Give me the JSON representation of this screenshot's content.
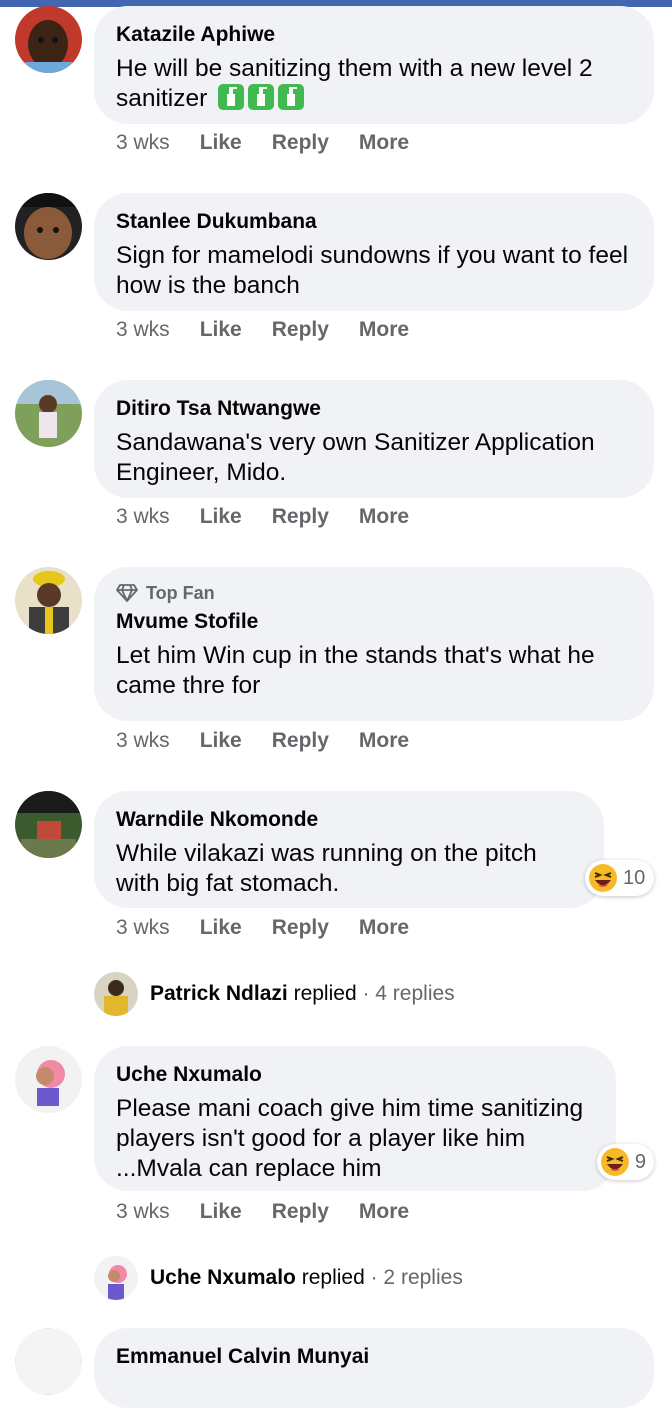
{
  "comments": [
    {
      "name": "Katazile Aphiwe",
      "text": "He will be sanitizing them with a new level 2 sanitizer",
      "icons": [
        "sanitizer-icon",
        "sanitizer-icon",
        "sanitizer-icon"
      ],
      "time": "3 wks"
    },
    {
      "name": "Stanlee Dukumbana",
      "text": "Sign for mamelodi sundowns if you want to feel how is the banch",
      "time": "3 wks"
    },
    {
      "name": "Ditiro Tsa Ntwangwe",
      "text": "Sandawana's very own Sanitizer Application Engineer, Mido.",
      "time": "3 wks"
    },
    {
      "badge": "Top Fan",
      "name": "Mvume Stofile",
      "text": "Let him Win cup in the stands that's what he came thre for",
      "time": "3 wks"
    },
    {
      "name": "Warndile Nkomonde",
      "text": "While vilakazi was running on the pitch with big fat stomach.",
      "reaction": {
        "icon": "laughing-emoji-icon",
        "count": "10"
      },
      "time": "3 wks"
    },
    {
      "name": "Uche Nxumalo",
      "text": "Please mani coach give him time sanitizing players isn't good for a player like him ...Mvala can replace him",
      "reaction": {
        "icon": "laughing-emoji-icon",
        "count": "9"
      },
      "time": "3 wks"
    },
    {
      "name": "Emmanuel Calvin Munyai"
    }
  ],
  "actions": {
    "like": "Like",
    "reply": "Reply",
    "more": "More"
  },
  "replies": [
    {
      "name": "Patrick Ndlazi",
      "verb": "replied",
      "count": "· 4 replies"
    },
    {
      "name": "Uche Nxumalo",
      "verb": "replied",
      "count": "· 2 replies"
    }
  ],
  "colors": {
    "bubble": "#f0f2f5",
    "meta": "#65676b",
    "topbar": "#4267b2"
  }
}
